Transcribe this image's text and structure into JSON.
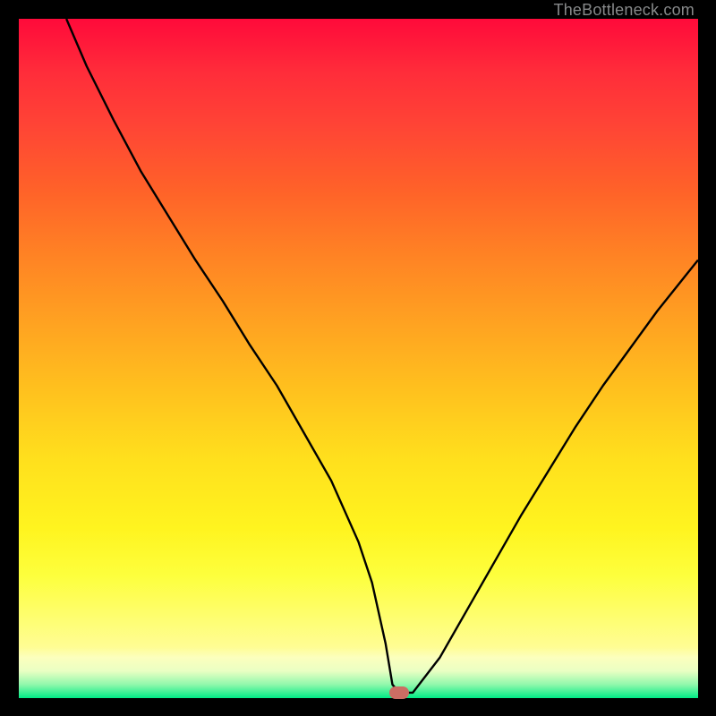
{
  "attribution": "TheBottleneck.com",
  "marker": {
    "x_pct": 56.0,
    "y_pct": 99.2
  },
  "colors": {
    "background": "#000000",
    "marker": "#cc6d63",
    "curve": "#000000",
    "attribution": "#87898a",
    "gradient": [
      "#ff0a3a",
      "#ff4535",
      "#ff8324",
      "#ffc21e",
      "#fff41f",
      "#fffd94",
      "#91f8ac",
      "#00eb85"
    ]
  },
  "chart_data": {
    "type": "line",
    "title": "",
    "xlabel": "",
    "ylabel": "",
    "xlim": [
      0,
      100
    ],
    "ylim": [
      0,
      100
    ],
    "grid": false,
    "legend": false,
    "series": [
      {
        "name": "bottleneck-curve",
        "x": [
          7,
          10,
          14,
          18,
          22,
          26,
          30,
          34,
          38,
          42,
          46,
          50,
          52,
          54,
          55,
          56,
          58,
          62,
          66,
          70,
          74,
          78,
          82,
          86,
          90,
          94,
          98,
          100
        ],
        "y": [
          100,
          93,
          85,
          77.5,
          71,
          64.5,
          58.5,
          52,
          46,
          39,
          32,
          23,
          17,
          8,
          2,
          0.8,
          0.8,
          6,
          13,
          20,
          27,
          33.5,
          40,
          46,
          51.5,
          57,
          62,
          64.5
        ]
      }
    ],
    "annotations": [
      {
        "type": "marker",
        "x": 56,
        "y": 0.8,
        "shape": "rounded-rect",
        "color": "#cc6d63"
      }
    ]
  }
}
